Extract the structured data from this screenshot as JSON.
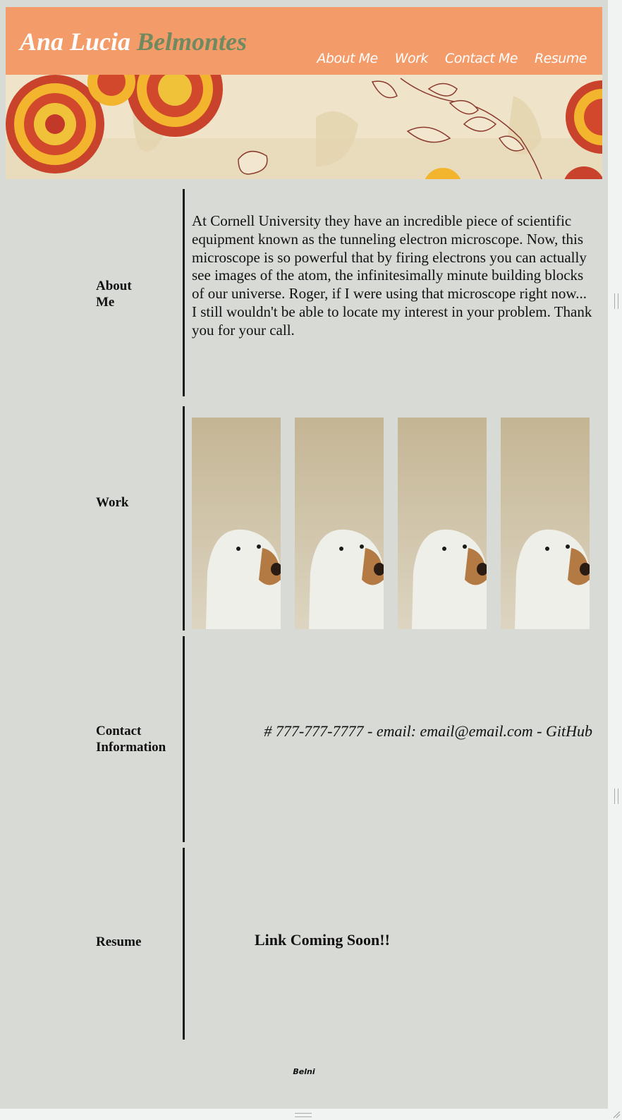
{
  "header": {
    "first_name": "Ana Lucia",
    "last_name": "Belmontes",
    "nav": [
      "About Me",
      "Work",
      "Contact Me",
      "Resume"
    ]
  },
  "colors": {
    "header_bg": "#f49b6a",
    "page_bg": "#d8dad6",
    "last_name": "#6f8960",
    "divider": "#1c1c1c"
  },
  "sections": {
    "about": {
      "label": "About Me",
      "text": "At Cornell University they have an incredible piece of scientific equipment known as the tunneling electron microscope. Now, this microscope is so powerful that by firing electrons you can actually see images of the atom, the infinitesimally minute building blocks of our universe. Roger, if I were using that microscope right now... I still wouldn't be able to locate my interest in your problem. Thank you for your call."
    },
    "work": {
      "label": "Work",
      "photos": [
        "ghost-dog-photo",
        "ghost-dog-photo",
        "ghost-dog-photo",
        "ghost-dog-photo"
      ]
    },
    "contact": {
      "label": "Contact Information",
      "phone": "# 777-777-7777",
      "sep1": " - ",
      "email": "email: email@email.com",
      "sep2": " - ",
      "github": "GitHub"
    },
    "resume": {
      "label": "Resume",
      "link_text": "Link Coming Soon!!"
    }
  },
  "footer": {
    "text": "Belni"
  }
}
